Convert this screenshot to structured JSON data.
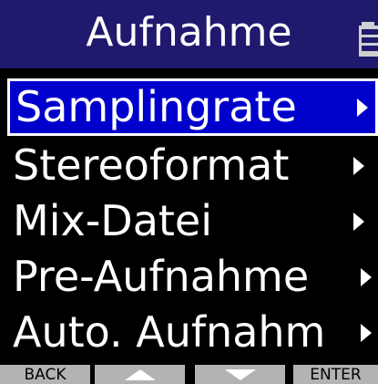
{
  "header": {
    "title": "Aufnahme",
    "battery_icon": "battery-icon"
  },
  "menu": {
    "items": [
      {
        "label": "Samplingrate",
        "selected": true,
        "icon": "chevron-right-icon"
      },
      {
        "label": "Stereoformat",
        "selected": false,
        "icon": "chevron-right-icon"
      },
      {
        "label": "Mix-Datei",
        "selected": false,
        "icon": "chevron-right-icon"
      },
      {
        "label": "Pre-Aufnahme",
        "selected": false,
        "icon": "chevron-right-icon"
      },
      {
        "label": "Auto. Aufnahm",
        "selected": false,
        "icon": "chevron-right-icon"
      }
    ]
  },
  "footer": {
    "back_label": "BACK",
    "up_icon": "triangle-up-icon",
    "down_icon": "triangle-down-icon",
    "enter_label": "ENTER"
  },
  "colors": {
    "header_bg": "#1f1a6e",
    "selection_bg": "#0000cc",
    "screen_bg": "#000000",
    "footer_bg": "#b3b3b3"
  }
}
